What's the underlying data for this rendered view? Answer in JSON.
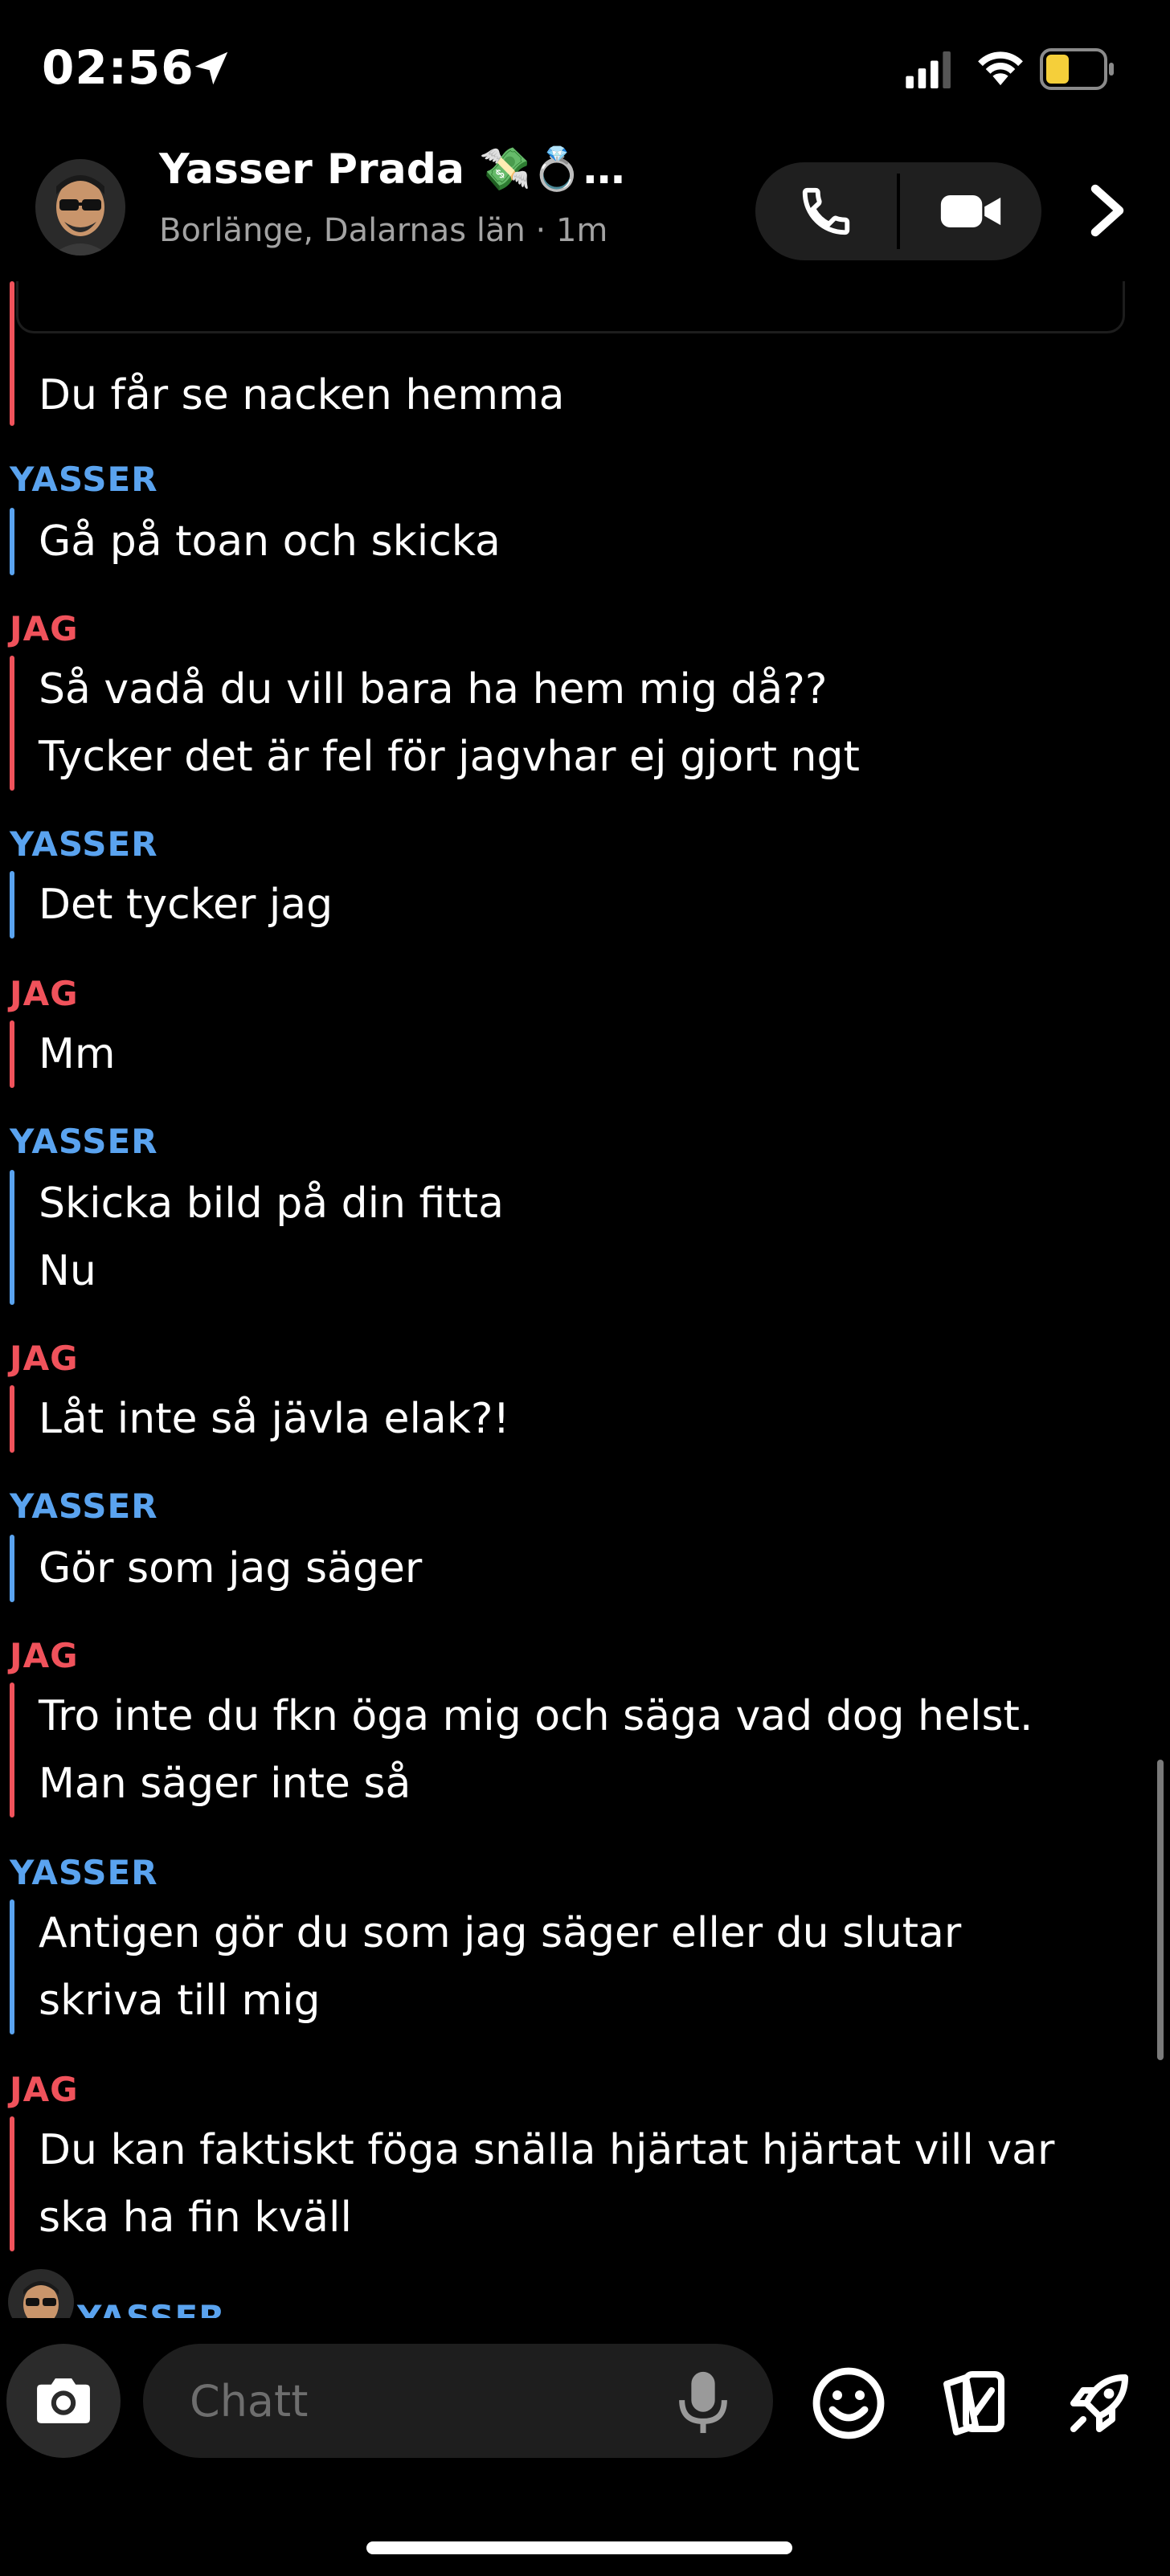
{
  "status_bar": {
    "time": "02:56"
  },
  "header": {
    "contact_name": "Yasser Prada 💸💍…",
    "subtitle": "Borlänge, Dalarnas län · 1m"
  },
  "messages": [
    {
      "sender": "",
      "lines": [
        "Du får se nacken hemma"
      ]
    },
    {
      "sender": "YASSER",
      "lines": [
        "Gå på toan och skicka"
      ]
    },
    {
      "sender": "JAG",
      "lines": [
        "Så vadå du vill bara ha hem mig då??",
        "Tycker det är fel för jagvhar ej gjort ngt"
      ]
    },
    {
      "sender": "YASSER",
      "lines": [
        "Det tycker jag"
      ]
    },
    {
      "sender": "JAG",
      "lines": [
        "Mm"
      ]
    },
    {
      "sender": "YASSER",
      "lines": [
        "Skicka bild på din fitta",
        "Nu"
      ]
    },
    {
      "sender": "JAG",
      "lines": [
        "Låt inte så jävla elak?!"
      ]
    },
    {
      "sender": "YASSER",
      "lines": [
        "Gör som jag säger"
      ]
    },
    {
      "sender": "JAG",
      "lines": [
        "Tro inte du fkn öga mig och säga vad dog helst.",
        "Man säger inte så"
      ]
    },
    {
      "sender": "YASSER",
      "lines": [
        "Antigen gör du som jag säger eller du slutar",
        "skriva till mig"
      ]
    },
    {
      "sender": "JAG",
      "lines": [
        "Du kan faktiskt föga snälla hjärtat hjärtat vill var",
        "ska ha fin kväll"
      ]
    }
  ],
  "peek_sender": "YASSER",
  "input": {
    "placeholder": "Chatt"
  },
  "colors": {
    "yasser": "#5aa3ef",
    "jag": "#f0525b",
    "background": "#000000"
  },
  "icons": [
    "location-arrow-icon",
    "signal-icon",
    "wifi-icon",
    "battery-icon",
    "phone-icon",
    "video-icon",
    "chevron-right-icon",
    "camera-icon",
    "microphone-icon",
    "smiley-icon",
    "cards-icon",
    "rocket-icon"
  ]
}
